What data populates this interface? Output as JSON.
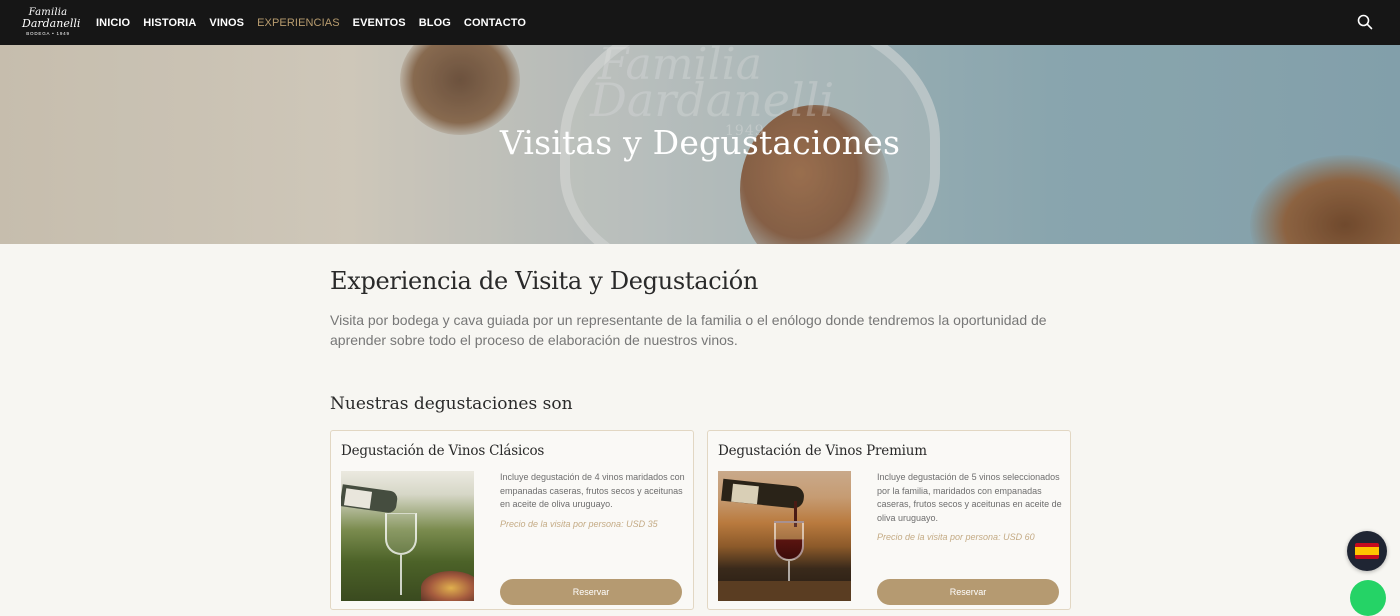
{
  "brand": {
    "logo_line1": "Familia",
    "logo_line2": "Dardanelli",
    "logo_line3": "BODEGA • 1949"
  },
  "nav": {
    "items": [
      {
        "label": "INICIO",
        "active": false
      },
      {
        "label": "HISTORIA",
        "active": false
      },
      {
        "label": "VINOS",
        "active": false
      },
      {
        "label": "EXPERIENCIAS",
        "active": true
      },
      {
        "label": "EVENTOS",
        "active": false
      },
      {
        "label": "BLOG",
        "active": false
      },
      {
        "label": "CONTACTO",
        "active": false
      }
    ],
    "search_icon": "search-icon",
    "active_color": "#b89c6f"
  },
  "hero": {
    "title": "Visitas y Degustaciones",
    "glass_etching_line1": "Familia",
    "glass_etching_line2": "Dardanelli",
    "glass_etching_line3": "1949"
  },
  "main": {
    "heading": "Experiencia de Visita y Degustación",
    "intro": "Visita por bodega y cava guiada por un representante de la familia o el enólogo donde tendremos la oportunidad de aprender sobre todo el proceso de elaboración de nuestros vinos.",
    "subheading": "Nuestras degustaciones son"
  },
  "cards": [
    {
      "title": "Degustación de Vinos Clásicos",
      "description": "Incluye degustación de 4 vinos maridados con empanadas caseras, frutos secos y aceitunas en aceite de oliva uruguayo.",
      "price": "Precio de la visita por persona: USD 35",
      "button_label": "Reservar"
    },
    {
      "title": "Degustación de Vinos Premium",
      "description": "Incluye degustación de 5 vinos seleccionados por la familia, maridados con empanadas caseras, frutos secos y aceitunas en aceite de oliva uruguayo.",
      "price": "Precio de la visita por persona: USD 60",
      "button_label": "Reservar"
    }
  ],
  "floating": {
    "language_icon": "spain-flag-icon",
    "whatsapp_icon": "whatsapp-icon"
  },
  "colors": {
    "navbar": "#161616",
    "accent": "#b59a71",
    "page_bg": "#f7f6f2"
  }
}
